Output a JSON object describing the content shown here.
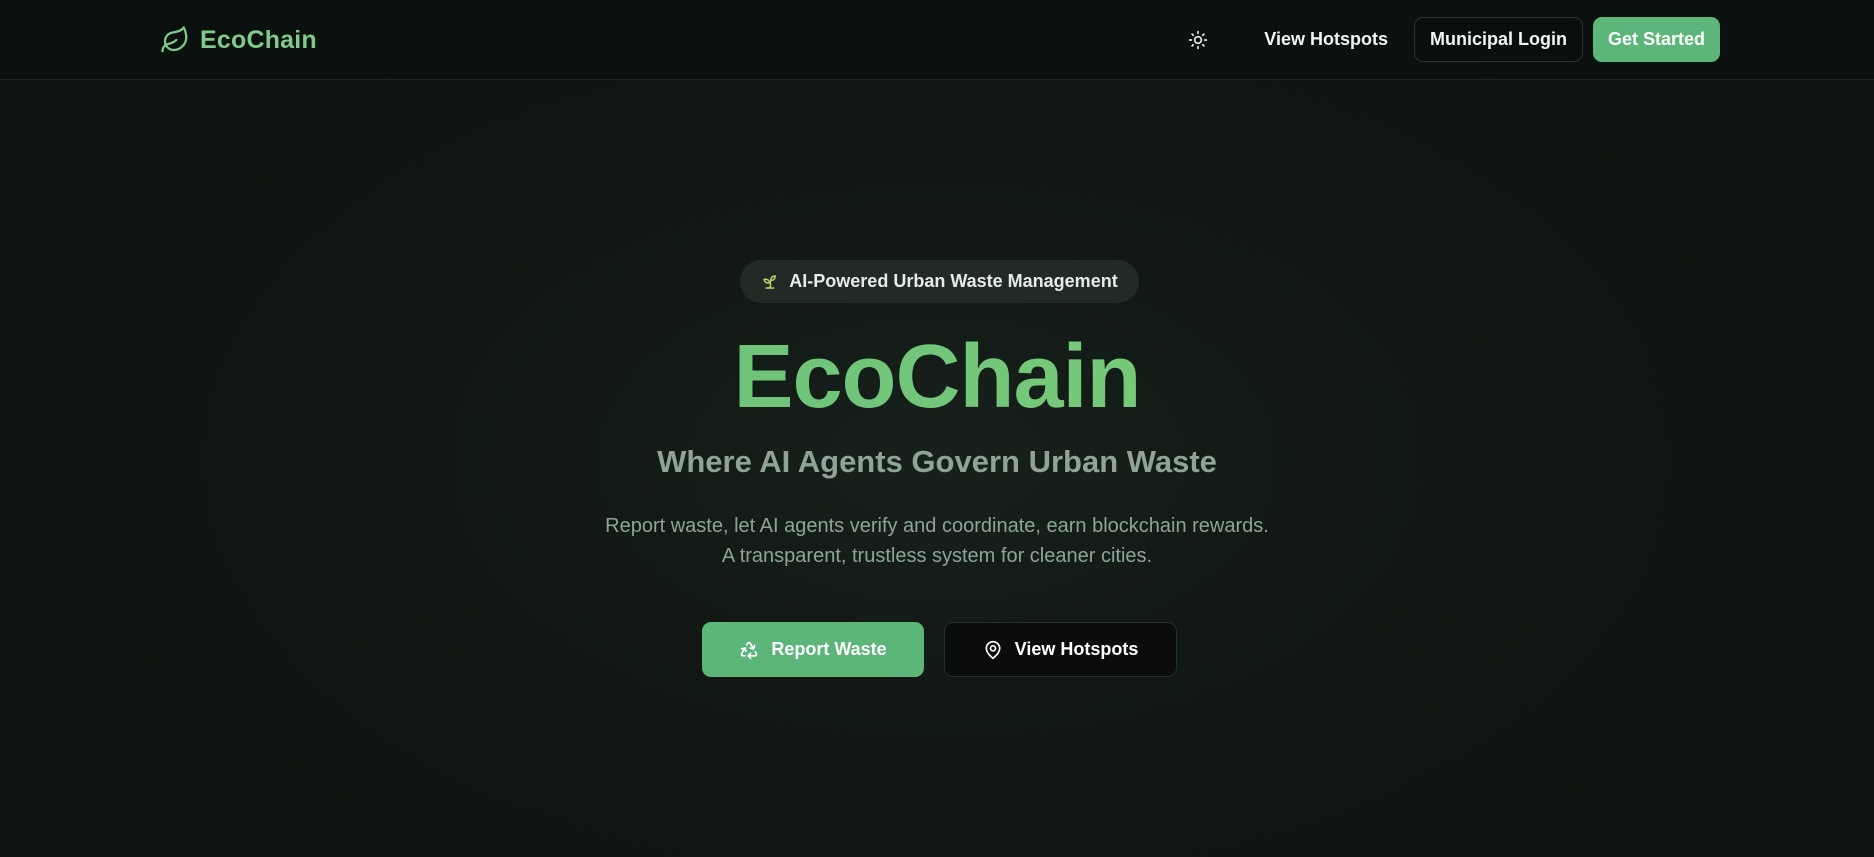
{
  "header": {
    "brand_name": "EcoChain",
    "brand_icon": "leaf-icon",
    "theme_icon": "sun-icon",
    "nav_view_hotspots": "View Hotspots",
    "nav_municipal_login": "Municipal Login",
    "nav_get_started": "Get Started"
  },
  "hero": {
    "badge_icon": "sprout-icon",
    "badge_text": "AI-Powered Urban Waste Management",
    "title": "EcoChain",
    "subtitle": "Where AI Agents Govern Urban Waste",
    "description_line1": "Report waste, let AI agents verify and coordinate, earn blockchain rewards.",
    "description_line2": "A transparent, trustless system for cleaner cities.",
    "report_button": "Report Waste",
    "report_icon": "recycle-icon",
    "hotspots_button": "View Hotspots",
    "hotspots_icon": "map-pin-icon"
  },
  "colors": {
    "brand_green": "#5cb67a",
    "title_green": "#77c97a",
    "background": "#0f1613",
    "text_muted": "#8fa396"
  }
}
